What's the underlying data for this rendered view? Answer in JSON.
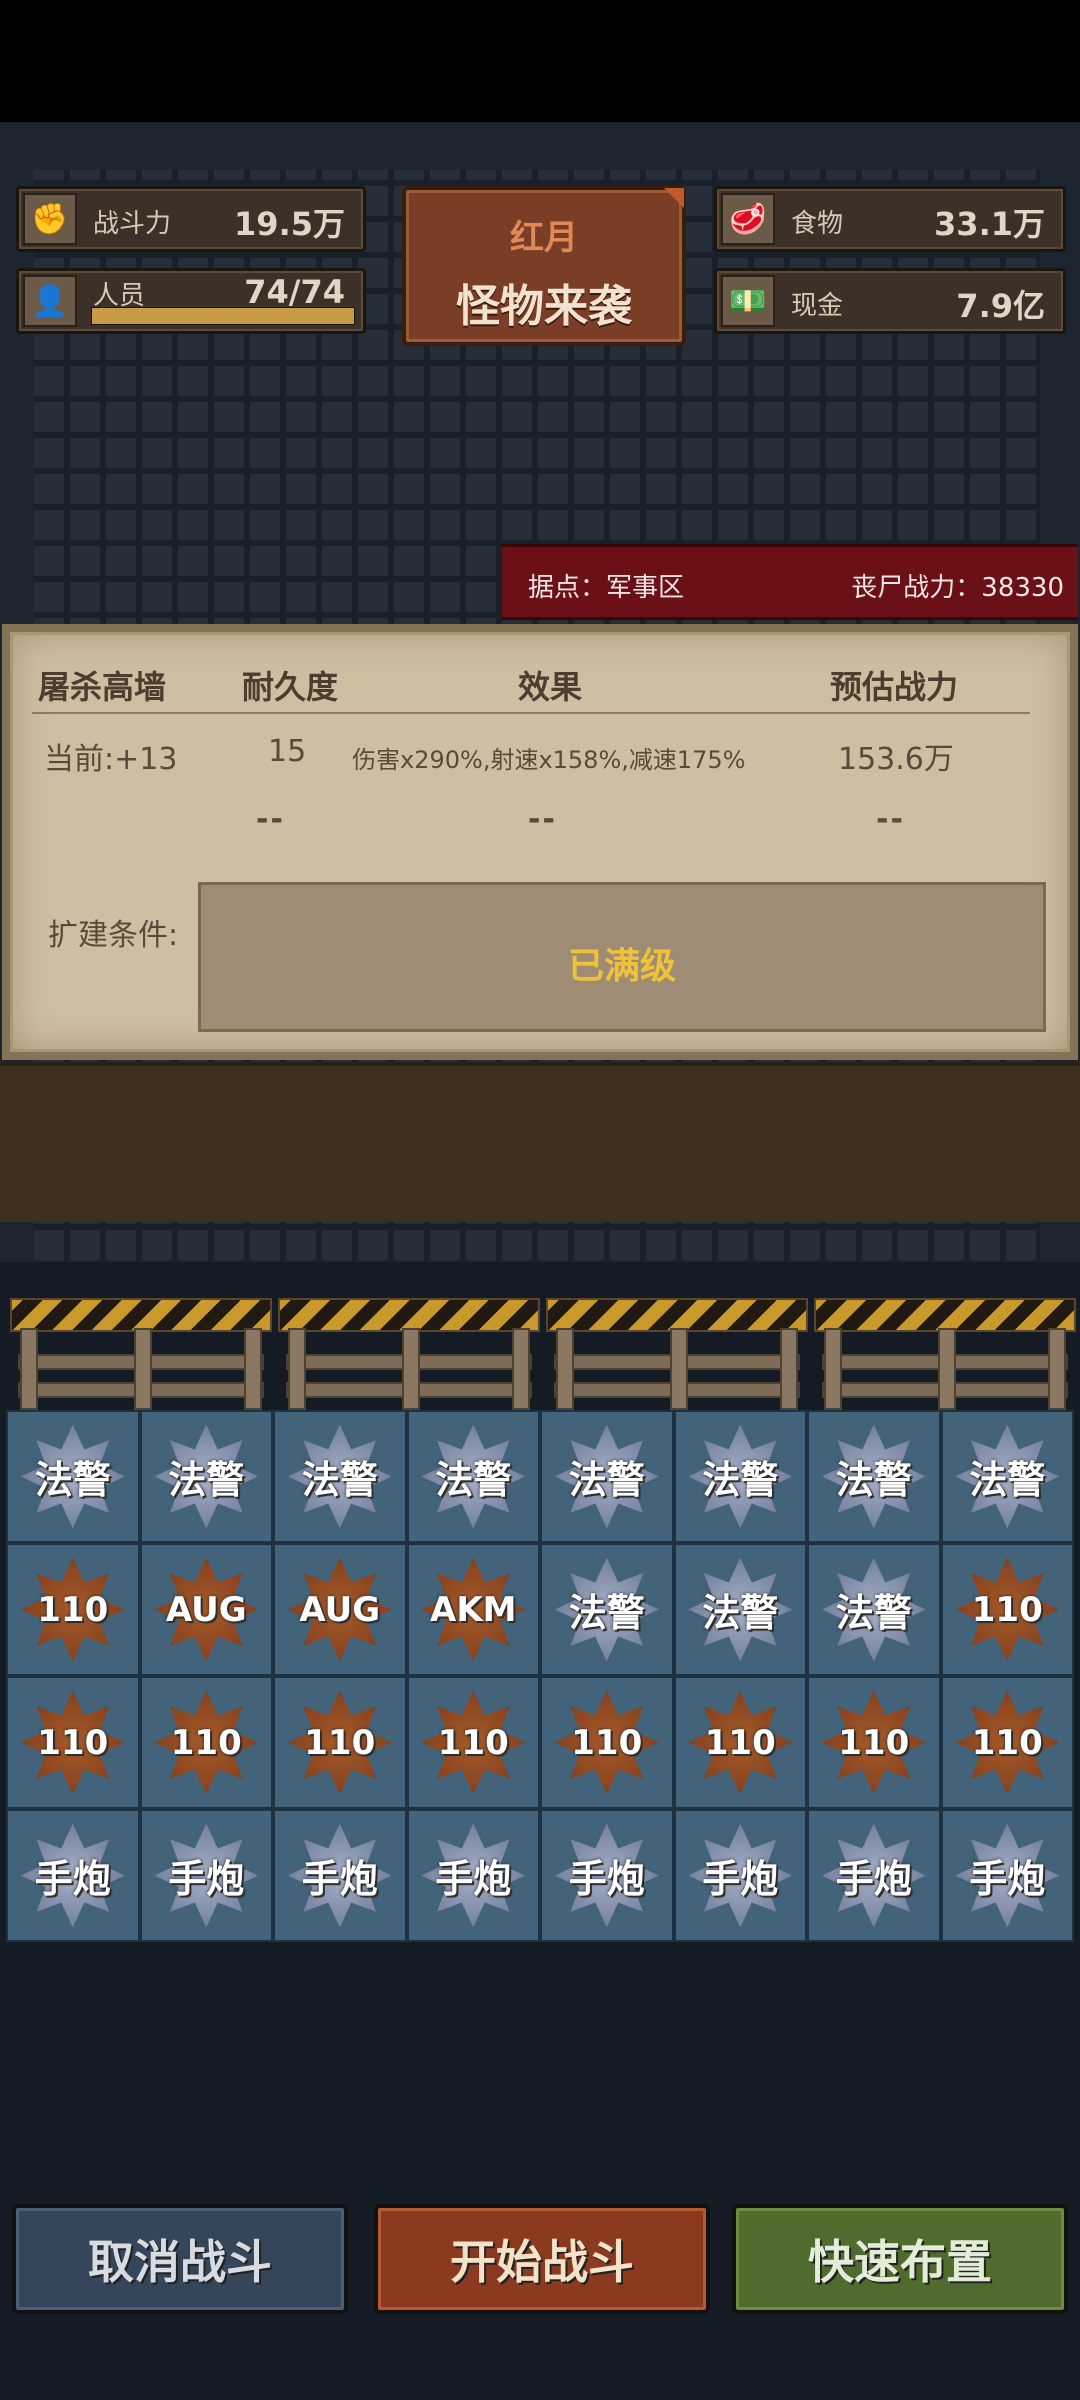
{
  "stats": {
    "power": {
      "label": "战斗力",
      "value": "19.5万",
      "icon": "fist-icon"
    },
    "staff": {
      "label": "人员",
      "value": "74/74",
      "progress": 1.0,
      "icon": "person-icon"
    },
    "food": {
      "label": "食物",
      "value": "33.1万",
      "icon": "meat-icon"
    },
    "cash": {
      "label": "现金",
      "value": "7.9亿",
      "icon": "cash-icon"
    }
  },
  "event": {
    "line1": "红月",
    "line2": "怪物来袭"
  },
  "stronghold": {
    "location": "据点：军事区",
    "zombie_power": "丧尸战力：38330"
  },
  "panel": {
    "headers": [
      "屠杀高墙",
      "耐久度",
      "效果",
      "预估战力"
    ],
    "current": {
      "level": "当前:+13",
      "durability": "15",
      "effect": "伤害x290%,射速x158%,减速175%",
      "power": "153.6万"
    },
    "next": {
      "durability": "--",
      "effect": "--",
      "power": "--"
    },
    "condition_label": "扩建条件:",
    "condition_value": "已满级"
  },
  "grid": [
    [
      {
        "t": "法警",
        "c": "silver"
      },
      {
        "t": "法警",
        "c": "silver"
      },
      {
        "t": "法警",
        "c": "silver"
      },
      {
        "t": "法警",
        "c": "silver"
      },
      {
        "t": "法警",
        "c": "silver"
      },
      {
        "t": "法警",
        "c": "silver"
      },
      {
        "t": "法警",
        "c": "silver"
      },
      {
        "t": "法警",
        "c": "silver"
      }
    ],
    [
      {
        "t": "110",
        "c": "bronze"
      },
      {
        "t": "AUG",
        "c": "bronze"
      },
      {
        "t": "AUG",
        "c": "bronze"
      },
      {
        "t": "AKM",
        "c": "bronze"
      },
      {
        "t": "法警",
        "c": "silver"
      },
      {
        "t": "法警",
        "c": "silver"
      },
      {
        "t": "法警",
        "c": "silver"
      },
      {
        "t": "110",
        "c": "bronze"
      }
    ],
    [
      {
        "t": "110",
        "c": "bronze"
      },
      {
        "t": "110",
        "c": "bronze"
      },
      {
        "t": "110",
        "c": "bronze"
      },
      {
        "t": "110",
        "c": "bronze"
      },
      {
        "t": "110",
        "c": "bronze"
      },
      {
        "t": "110",
        "c": "bronze"
      },
      {
        "t": "110",
        "c": "bronze"
      },
      {
        "t": "110",
        "c": "bronze"
      }
    ],
    [
      {
        "t": "手炮",
        "c": "silver"
      },
      {
        "t": "手炮",
        "c": "silver"
      },
      {
        "t": "手炮",
        "c": "silver"
      },
      {
        "t": "手炮",
        "c": "silver"
      },
      {
        "t": "手炮",
        "c": "silver"
      },
      {
        "t": "手炮",
        "c": "silver"
      },
      {
        "t": "手炮",
        "c": "silver"
      },
      {
        "t": "手炮",
        "c": "silver"
      }
    ]
  ],
  "buttons": {
    "cancel": "取消战斗",
    "start": "开始战斗",
    "quick": "快速布置"
  }
}
